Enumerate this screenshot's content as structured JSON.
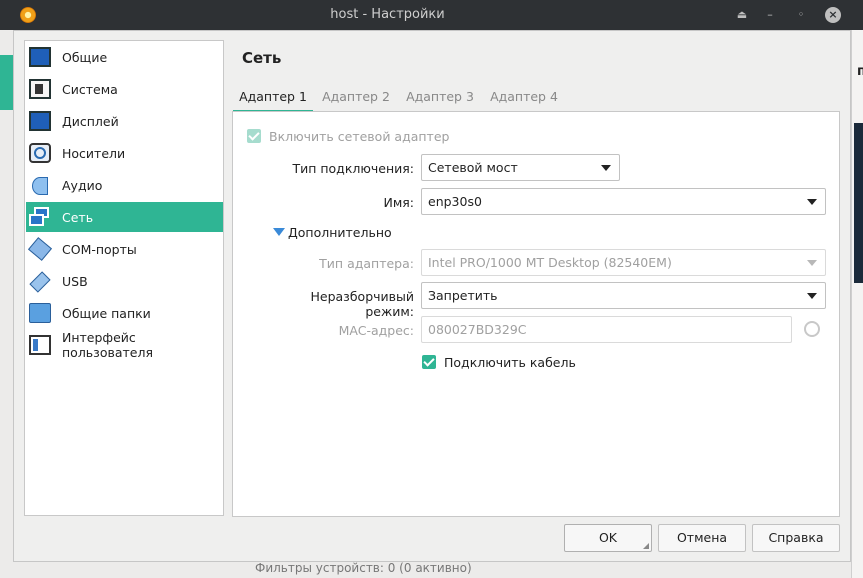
{
  "window": {
    "title": "host - Настройки"
  },
  "background": {
    "right_letter": "п",
    "bottom_text": "Фильтры устройств:   0 (0 активно)"
  },
  "sidebar": {
    "items": [
      {
        "label": "Общие",
        "icon": "monitor-icon"
      },
      {
        "label": "Система",
        "icon": "motherboard-icon"
      },
      {
        "label": "Дисплей",
        "icon": "display-icon"
      },
      {
        "label": "Носители",
        "icon": "storage-disc-icon"
      },
      {
        "label": "Аудио",
        "icon": "speaker-icon"
      },
      {
        "label": "Сеть",
        "icon": "network-icon",
        "active": true
      },
      {
        "label": "COM-порты",
        "icon": "serial-port-icon"
      },
      {
        "label": "USB",
        "icon": "usb-icon"
      },
      {
        "label": "Общие папки",
        "icon": "shared-folder-icon"
      },
      {
        "label": "Интерфейс пользователя",
        "icon": "user-interface-icon"
      }
    ]
  },
  "page": {
    "title": "Сеть"
  },
  "tabs": [
    {
      "label": "Адаптер 1",
      "active": true
    },
    {
      "label": "Адаптер 2"
    },
    {
      "label": "Адаптер 3"
    },
    {
      "label": "Адаптер 4"
    }
  ],
  "adapter": {
    "enable_label": "Включить сетевой адаптер",
    "enable_checked": true,
    "attachment_label": "Тип подключения:",
    "attachment_value": "Сетевой мост",
    "name_label": "Имя:",
    "name_value": "enp30s0",
    "advanced_label": "Дополнительно",
    "adapter_type_label": "Тип адаптера:",
    "adapter_type_value": "Intel PRO/1000 MT Desktop (82540EM)",
    "promisc_label": "Неразборчивый режим:",
    "promisc_value": "Запретить",
    "mac_label": "MAC-адрес:",
    "mac_value": "080027BD329C",
    "cable_label": "Подключить кабель",
    "cable_checked": true
  },
  "buttons": {
    "ok": "OK",
    "cancel": "Отмена",
    "help": "Справка"
  },
  "colors": {
    "accent": "#2fb594",
    "titlebar": "#2e3134"
  }
}
